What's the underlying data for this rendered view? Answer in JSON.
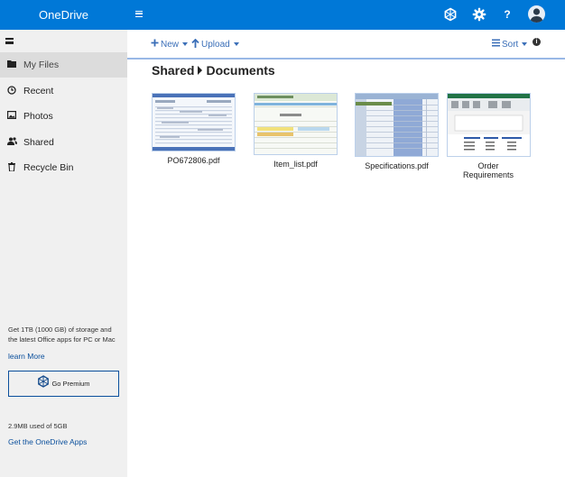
{
  "app": {
    "title": "OneDrive"
  },
  "colors": {
    "brand": "#0078d7",
    "link": "#0a4f9c",
    "command": "#3b6fb8",
    "sidebar_bg": "#f0f0f0",
    "active_item_bg": "#dcdcdc"
  },
  "sidebar": {
    "items": [
      {
        "label": "My Files",
        "icon": "folder-icon",
        "active": true
      },
      {
        "label": "Recent",
        "icon": "clock-icon",
        "active": false
      },
      {
        "label": "Photos",
        "icon": "image-icon",
        "active": false
      },
      {
        "label": "Shared",
        "icon": "users-icon",
        "active": false
      },
      {
        "label": "Recycle Bin",
        "icon": "trash-icon",
        "active": false
      }
    ],
    "promo_text": "Get 1TB (1000 GB) of storage and the latest Office apps for PC or Mac",
    "learn_more": "learn More",
    "premium_label": "Go Premium",
    "storage_text": "2.9MB used of 5GB",
    "get_apps": "Get the OneDrive Apps"
  },
  "topbar": {
    "icons": [
      "menu-icon",
      "office-apps-icon",
      "settings-icon",
      "help-icon",
      "avatar"
    ],
    "help_glyph": "?"
  },
  "commands": {
    "new_label": "New",
    "upload_label": "Upload",
    "sort_label": "Sort"
  },
  "breadcrumb": [
    "Shared",
    "Documents"
  ],
  "files": [
    {
      "name": "PO672806.pdf"
    },
    {
      "name": "Item_list.pdf"
    },
    {
      "name": "Specifications.pdf"
    },
    {
      "name": "Order Requirements"
    }
  ]
}
